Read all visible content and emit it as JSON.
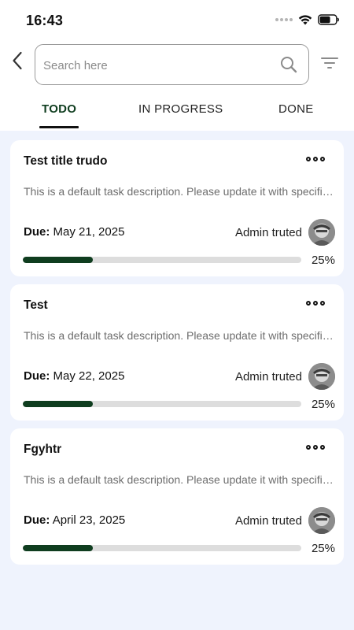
{
  "status_bar": {
    "time": "16:43",
    "icons": [
      "cellular-dots-icon",
      "wifi-icon",
      "battery-icon"
    ]
  },
  "search": {
    "placeholder": "Search here",
    "value": ""
  },
  "tabs": [
    {
      "label": "TODO",
      "active": true
    },
    {
      "label": "IN PROGRESS",
      "active": false
    },
    {
      "label": "DONE",
      "active": false
    }
  ],
  "colors": {
    "accent": "#0f3d1f",
    "list_background": "#eff3fd",
    "track": "#dddddd"
  },
  "tasks": [
    {
      "title": "Test title trudo",
      "description": "This is a default task description. Please update it with specific details.",
      "due_label": "Due:",
      "due_date": "May 21, 2025",
      "assignee": "Admin truted",
      "progress": 0.25,
      "progress_label": "25%"
    },
    {
      "title": "Test",
      "description": "This is a default task description. Please update it with specific details.",
      "due_label": "Due:",
      "due_date": "May 22, 2025",
      "assignee": "Admin truted",
      "progress": 0.25,
      "progress_label": "25%"
    },
    {
      "title": "Fgyhtr",
      "description": "This is a default task description. Please update it with specific details.",
      "due_label": "Due:",
      "due_date": "April 23, 2025",
      "assignee": "Admin truted",
      "progress": 0.25,
      "progress_label": "25%"
    }
  ]
}
